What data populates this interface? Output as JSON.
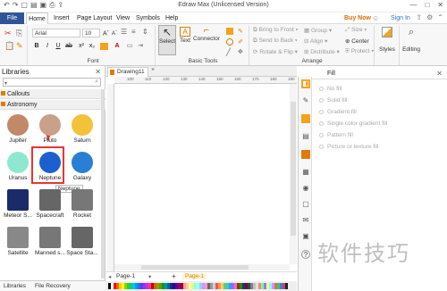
{
  "window": {
    "title": "Edraw Max (Unlicensed Version)"
  },
  "menu": {
    "file": "File",
    "items": [
      "Home",
      "Insert",
      "Page Layout",
      "View",
      "Symbols",
      "Help"
    ],
    "buy_now": "Buy Now",
    "sign_in": "Sign In"
  },
  "ribbon": {
    "font_name": "Arial",
    "font_size": "10",
    "font_group": "Font",
    "tools": {
      "select": "Select",
      "text": "Text",
      "connector": "Connector",
      "group": "Basic Tools"
    },
    "arrange": {
      "bring_to_front": "Bring to Front",
      "send_to_back": "Send to Back",
      "rotate_flip": "Rotate & Flip",
      "group": "Group",
      "align": "Align",
      "distribute": "Distribute",
      "size": "Size",
      "center": "Center",
      "protect": "Protect",
      "label": "Arrange"
    },
    "styles": "Styles",
    "editing": "Editing"
  },
  "libraries": {
    "title": "Libraries",
    "sections": [
      "Callouts",
      "Astronomy"
    ],
    "shapes": [
      {
        "label": "Jupiter",
        "color": "#c08a6a"
      },
      {
        "label": "Pluto",
        "color": "#c9a08a"
      },
      {
        "label": "Saturn",
        "color": "#f2c23a"
      },
      {
        "label": "Uranus",
        "color": "#8ee8d0"
      },
      {
        "label": "Neptune",
        "color": "#1e5fd0"
      },
      {
        "label": "Galaxy",
        "color": "#2a7fd4"
      },
      {
        "label": "Meteor S...",
        "color": "#1b2a6b"
      },
      {
        "label": "Spacecraft",
        "color": "#666666"
      },
      {
        "label": "Rocket",
        "color": "#777777"
      },
      {
        "label": "Satellite",
        "color": "#888888"
      },
      {
        "label": "Manned s...",
        "color": "#777777"
      },
      {
        "label": "Space Sta...",
        "color": "#666666"
      }
    ],
    "tooltip": "Neptune",
    "bottom_tabs": [
      "Libraries",
      "File Recovery"
    ]
  },
  "document": {
    "tab": "Drawing11",
    "ruler_ticks": [
      "100",
      "110",
      "120",
      "130",
      "140",
      "150",
      "160",
      "170",
      "180",
      "190"
    ],
    "page_tab": "Page-1",
    "active_page": "Page-1"
  },
  "fill_panel": {
    "title": "Fill",
    "options": [
      "No fill",
      "Solid fill",
      "Gradient fill",
      "Single color gradient fill",
      "Pattern fill",
      "Picture or texture fill"
    ]
  },
  "watermark": "软件技巧",
  "palette": [
    "#000000",
    "#ffffff",
    "#ff0000",
    "#ff6600",
    "#ffcc00",
    "#ffff00",
    "#99cc00",
    "#33cc33",
    "#00cc99",
    "#00cccc",
    "#0099ff",
    "#3366ff",
    "#6633ff",
    "#9933ff",
    "#cc33cc",
    "#ff3399",
    "#cc0000",
    "#cc6600",
    "#999900",
    "#669900",
    "#009933",
    "#009999",
    "#006699",
    "#003399",
    "#330099",
    "#660099",
    "#990066",
    "#990033",
    "#ff9999",
    "#ffcc99",
    "#ffff99",
    "#ccff99",
    "#99ffcc",
    "#99ffff",
    "#99ccff",
    "#cc99ff",
    "#ff99cc",
    "#666666",
    "#999999",
    "#cccccc",
    "#ff5050",
    "#ff9933",
    "#ffcc66",
    "#66cc66",
    "#33cccc",
    "#3399ff",
    "#9966ff",
    "#ff66cc",
    "#804000",
    "#408000",
    "#004080",
    "#800040",
    "#404040",
    "#808080",
    "#c0c0c0",
    "#e0e0e0",
    "#ff8080",
    "#80ff80",
    "#8080ff",
    "#ffff80",
    "#80ffff",
    "#ff80ff",
    "#c08040",
    "#40c080",
    "#4080c0",
    "#c04080",
    "#202020"
  ]
}
